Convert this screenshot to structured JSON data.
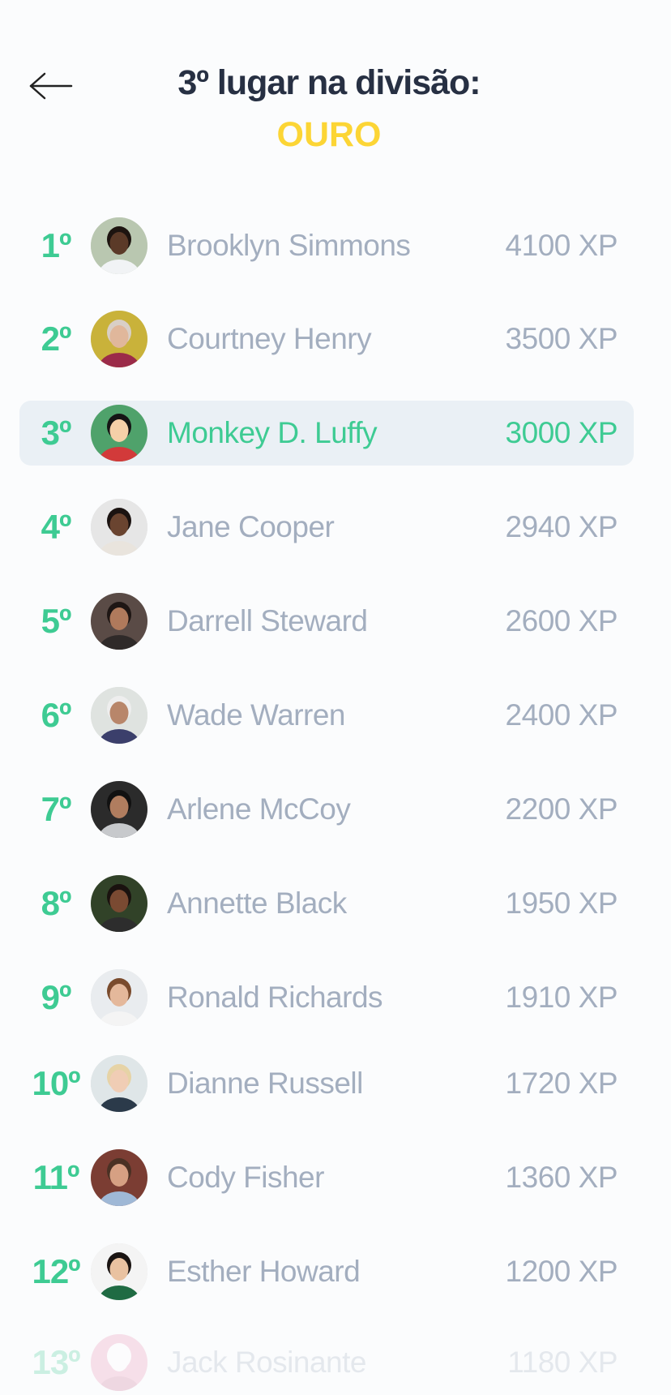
{
  "header": {
    "title": "3º lugar na divisão:",
    "division": "OURO",
    "back_icon": "arrow-left-icon"
  },
  "colors": {
    "accent_green": "#3ecb93",
    "gold": "#fcd535",
    "title": "#273043",
    "muted": "#a3aebf",
    "highlight_bg": "#eaf0f5"
  },
  "ranking": [
    {
      "rank": "1º",
      "name": "Brooklyn Simmons",
      "xp": "4100 XP",
      "avatar_bg": "#b9c7b0",
      "skin": "#5b3a28",
      "hair": "#1d1410",
      "shirt": "#f1f3f5"
    },
    {
      "rank": "2º",
      "name": "Courtney Henry",
      "xp": "3500 XP",
      "avatar_bg": "#c9b23a",
      "skin": "#e0b79b",
      "hair": "#d9cfc6",
      "shirt": "#9b2b49"
    },
    {
      "rank": "3º",
      "name": "Monkey D. Luffy",
      "xp": "3000 XP",
      "avatar_bg": "#4fa26b",
      "skin": "#f5d0a8",
      "hair": "#151515",
      "shirt": "#d23a3a"
    },
    {
      "rank": "4º",
      "name": "Jane Cooper",
      "xp": "2940 XP",
      "avatar_bg": "#e6e6e6",
      "skin": "#6a4430",
      "hair": "#1b1311",
      "shirt": "#e9e4dd"
    },
    {
      "rank": "5º",
      "name": "Darrell Steward",
      "xp": "2600 XP",
      "avatar_bg": "#5a4b46",
      "skin": "#b07a5c",
      "hair": "#1e1614",
      "shirt": "#2f2a29"
    },
    {
      "rank": "6º",
      "name": "Wade Warren",
      "xp": "2400 XP",
      "avatar_bg": "#dfe3e0",
      "skin": "#b8866a",
      "hair": "#eeeeee",
      "shirt": "#3b3f6b"
    },
    {
      "rank": "7º",
      "name": "Arlene McCoy",
      "xp": "2200 XP",
      "avatar_bg": "#2b2b2b",
      "skin": "#b07d5f",
      "hair": "#111111",
      "shirt": "#c7c9cc"
    },
    {
      "rank": "8º",
      "name": "Annette Black",
      "xp": "1950 XP",
      "avatar_bg": "#314228",
      "skin": "#7a4a32",
      "hair": "#1a120f",
      "shirt": "#2d2d2d"
    },
    {
      "rank": "9º",
      "name": "Ronald Richards",
      "xp": "1910 XP",
      "avatar_bg": "#e9ecef",
      "skin": "#e4b89b",
      "hair": "#7a4b2d",
      "shirt": "#f4f4f4"
    },
    {
      "rank": "10º",
      "name": "Dianne Russell",
      "xp": "1720 XP",
      "avatar_bg": "#dfe6e8",
      "skin": "#f0cdb5",
      "hair": "#e6d3a6",
      "shirt": "#2b3a4a"
    },
    {
      "rank": "11º",
      "name": "Cody Fisher",
      "xp": "1360 XP",
      "avatar_bg": "#7b3d33",
      "skin": "#d6a083",
      "hair": "#4a3124",
      "shirt": "#9fb8d6"
    },
    {
      "rank": "12º",
      "name": "Esther Howard",
      "xp": "1200 XP",
      "avatar_bg": "#f4f4f4",
      "skin": "#e9c2a1",
      "hair": "#1a1412",
      "shirt": "#1f6b43"
    },
    {
      "rank": "13º",
      "name": "Jack Rosinante",
      "xp": "1180 XP",
      "avatar_bg": "#e98bb0",
      "skin": "#ffffff",
      "hair": "#ffffff",
      "shirt": "#c96b8f"
    }
  ],
  "current_user_index": 2
}
